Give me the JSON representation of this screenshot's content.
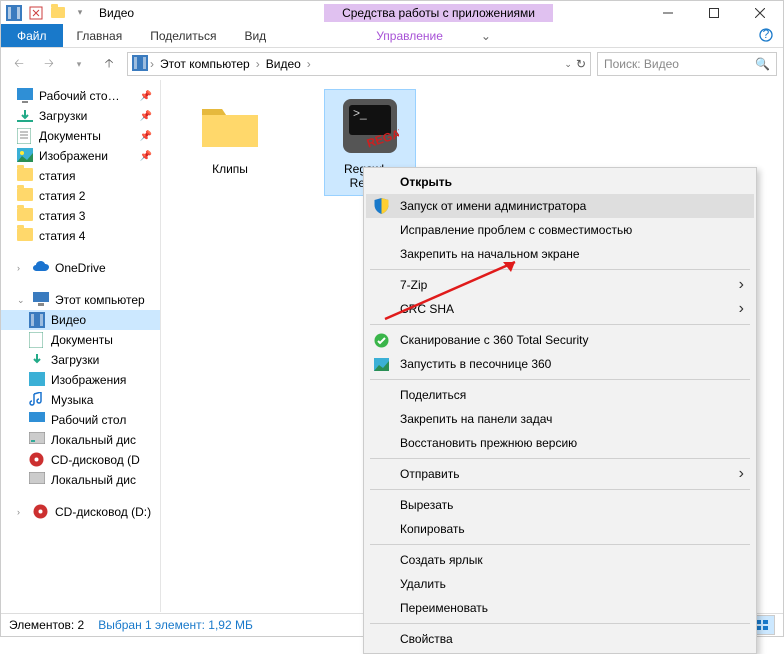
{
  "titlebar": {
    "title": "Видео",
    "tools_tab": "Средства работы с приложениями"
  },
  "ribbon": {
    "file": "Файл",
    "home": "Главная",
    "share": "Поделиться",
    "view": "Вид",
    "manage": "Управление"
  },
  "nav": {
    "crumb_pc": "Этот компьютер",
    "crumb_video": "Видео",
    "search_placeholder": "Поиск: Видео"
  },
  "sidebar": {
    "items": [
      {
        "label": "Рабочий сто…",
        "icon": "desktop",
        "pinned": true
      },
      {
        "label": "Загрузки",
        "icon": "downloads",
        "pinned": true
      },
      {
        "label": "Документы",
        "icon": "documents",
        "pinned": true
      },
      {
        "label": "Изображени",
        "icon": "pictures",
        "pinned": true
      },
      {
        "label": "статия",
        "icon": "folder"
      },
      {
        "label": "статия 2",
        "icon": "folder"
      },
      {
        "label": "статия 3",
        "icon": "folder"
      },
      {
        "label": "статия 4",
        "icon": "folder"
      }
    ],
    "onedrive": "OneDrive",
    "thispc": "Этот компьютер",
    "pc_items": [
      {
        "label": "Видео",
        "icon": "video",
        "selected": true
      },
      {
        "label": "Документы",
        "icon": "documents"
      },
      {
        "label": "Загрузки",
        "icon": "downloads"
      },
      {
        "label": "Изображения",
        "icon": "pictures"
      },
      {
        "label": "Музыка",
        "icon": "music"
      },
      {
        "label": "Рабочий стол",
        "icon": "desktop"
      },
      {
        "label": "Локальный дис",
        "icon": "disk"
      },
      {
        "label": "CD-дисковод (D",
        "icon": "cd-red"
      },
      {
        "label": "Локальный дис",
        "icon": "disk"
      }
    ],
    "cd2": "CD-дисковод (D:)"
  },
  "files": [
    {
      "name": "Клипы",
      "type": "folder"
    },
    {
      "name": "Regawl…\nRebo…",
      "type": "exe",
      "selected": true
    }
  ],
  "ctx": {
    "open": "Открыть",
    "run_admin": "Запуск от имени администратора",
    "compat": "Исправление проблем с совместимостью",
    "pin_start": "Закрепить на начальном экране",
    "seven_zip": "7-Zip",
    "crc": "CRC SHA",
    "scan360": "Сканирование с 360 Total Security",
    "sandbox360": "Запустить в песочнице 360",
    "share": "Поделиться",
    "pin_taskbar": "Закрепить на панели задач",
    "restore": "Восстановить прежнюю версию",
    "send_to": "Отправить",
    "cut": "Вырезать",
    "copy": "Копировать",
    "shortcut": "Создать ярлык",
    "delete": "Удалить",
    "rename": "Переименовать",
    "properties": "Свойства"
  },
  "status": {
    "count": "Элементов: 2",
    "selected": "Выбран 1 элемент: 1,92 МБ"
  }
}
